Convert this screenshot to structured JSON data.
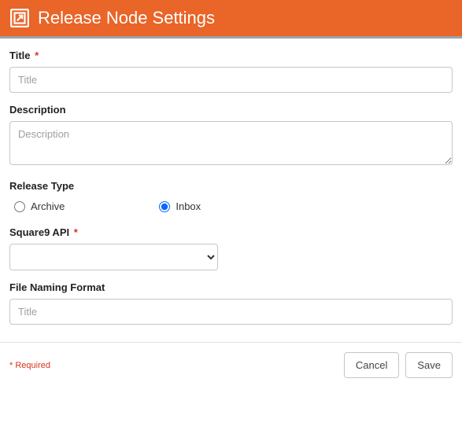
{
  "header": {
    "title": "Release Node Settings"
  },
  "fields": {
    "title": {
      "label": "Title",
      "required_mark": "*",
      "placeholder": "Title",
      "value": ""
    },
    "description": {
      "label": "Description",
      "placeholder": "Description",
      "value": ""
    },
    "release_type": {
      "label": "Release Type",
      "options": {
        "archive": {
          "label": "Archive",
          "selected": false
        },
        "inbox": {
          "label": "Inbox",
          "selected": true
        }
      }
    },
    "square9_api": {
      "label": "Square9 API",
      "required_mark": "*",
      "value": ""
    },
    "file_naming_format": {
      "label": "File Naming Format",
      "placeholder": "Title",
      "value": ""
    }
  },
  "footer": {
    "required_note": "* Required",
    "cancel_label": "Cancel",
    "save_label": "Save"
  }
}
